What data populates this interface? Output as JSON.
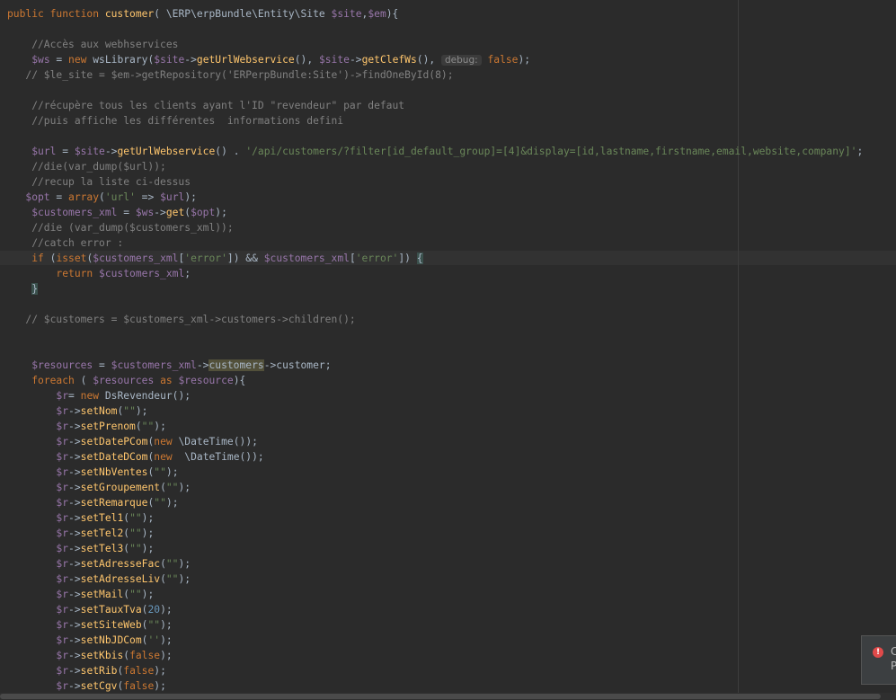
{
  "editor": {
    "lines": [
      [
        [
          "public function ",
          "kw"
        ],
        [
          "customer",
          "fn"
        ],
        [
          "( ",
          ""
        ],
        [
          "\\ERP\\erpBundle\\Entity\\Site",
          "cls"
        ],
        [
          " ",
          ""
        ],
        [
          "$site",
          "var"
        ],
        [
          ",",
          ""
        ],
        [
          "$em",
          "var"
        ],
        [
          "){",
          ""
        ]
      ],
      [],
      [
        [
          "    //Accès aux webhservices",
          "cmt"
        ]
      ],
      [
        [
          "    ",
          ""
        ],
        [
          "$ws",
          "var"
        ],
        [
          " = ",
          ""
        ],
        [
          "new ",
          "kw"
        ],
        [
          "wsLibrary(",
          ""
        ],
        [
          "$site",
          "var"
        ],
        [
          "->",
          ""
        ],
        [
          "getUrlWebservice",
          "fn"
        ],
        [
          "(), ",
          ""
        ],
        [
          "$site",
          "var"
        ],
        [
          "->",
          ""
        ],
        [
          "getClefWs",
          "fn"
        ],
        [
          "(), ",
          ""
        ],
        [
          "debug:",
          "hint"
        ],
        [
          " ",
          ""
        ],
        [
          "false",
          "kw"
        ],
        [
          ");",
          ""
        ]
      ],
      [
        [
          "   // $le_site = $em->getRepository('ERPerpBundle:Site')->findOneById(8);",
          "cmt"
        ]
      ],
      [],
      [
        [
          "    //récupère tous les clients ayant l'ID \"revendeur\" par defaut",
          "cmt"
        ]
      ],
      [
        [
          "    //puis affiche les différentes  informations defini",
          "cmt"
        ]
      ],
      [],
      [
        [
          "    ",
          ""
        ],
        [
          "$url",
          "var"
        ],
        [
          " = ",
          ""
        ],
        [
          "$site",
          "var"
        ],
        [
          "->",
          ""
        ],
        [
          "getUrlWebservice",
          "fn"
        ],
        [
          "() . ",
          ""
        ],
        [
          "'/api/customers/?filter[id_default_group]=[4]&display=[id,lastname,firstname,email,website,company]'",
          "str"
        ],
        [
          ";",
          ""
        ]
      ],
      [
        [
          "    //die(var_dump($url));",
          "cmt"
        ]
      ],
      [
        [
          "    //recup la liste ci-dessus",
          "cmt"
        ]
      ],
      [
        [
          "   ",
          ""
        ],
        [
          "$opt",
          "var"
        ],
        [
          " = ",
          ""
        ],
        [
          "array",
          "kw"
        ],
        [
          "(",
          ""
        ],
        [
          "'url'",
          "str"
        ],
        [
          " => ",
          ""
        ],
        [
          "$url",
          "var"
        ],
        [
          ");",
          ""
        ]
      ],
      [
        [
          "    ",
          ""
        ],
        [
          "$customers_xml",
          "var"
        ],
        [
          " = ",
          ""
        ],
        [
          "$ws",
          "var"
        ],
        [
          "->",
          ""
        ],
        [
          "get",
          "fn"
        ],
        [
          "(",
          ""
        ],
        [
          "$opt",
          "var"
        ],
        [
          ");",
          ""
        ]
      ],
      [
        [
          "    //die (var_dump($customers_xml));",
          "cmt"
        ]
      ],
      [
        [
          "    //catch error :",
          "cmt"
        ]
      ],
      [
        [
          "    ",
          ""
        ],
        [
          "if",
          "kw"
        ],
        [
          " (",
          ""
        ],
        [
          "isset",
          "kw"
        ],
        [
          "(",
          ""
        ],
        [
          "$customers_xml",
          "var"
        ],
        [
          "[",
          ""
        ],
        [
          "'error'",
          "str"
        ],
        [
          "]) && ",
          ""
        ],
        [
          "$customers_xml",
          "var"
        ],
        [
          "[",
          ""
        ],
        [
          "'error'",
          "str"
        ],
        [
          "]) ",
          ""
        ],
        [
          "{",
          "match"
        ]
      ],
      [
        [
          "        ",
          ""
        ],
        [
          "return ",
          "kw"
        ],
        [
          "$customers_xml",
          "var"
        ],
        [
          ";",
          ""
        ]
      ],
      [
        [
          "    ",
          ""
        ],
        [
          "}",
          "match"
        ]
      ],
      [],
      [
        [
          "   // $customers = $customers_xml->customers->children();",
          "cmt"
        ]
      ],
      [],
      [],
      [
        [
          "    ",
          ""
        ],
        [
          "$resources",
          "var"
        ],
        [
          " = ",
          ""
        ],
        [
          "$customers_xml",
          "var"
        ],
        [
          "->",
          ""
        ],
        [
          "customers",
          "occ"
        ],
        [
          "->customer;",
          ""
        ]
      ],
      [
        [
          "    ",
          ""
        ],
        [
          "foreach",
          "kw"
        ],
        [
          " ( ",
          ""
        ],
        [
          "$resources",
          "var"
        ],
        [
          " ",
          ""
        ],
        [
          "as",
          "kw"
        ],
        [
          " ",
          ""
        ],
        [
          "$resource",
          "var"
        ],
        [
          "){",
          ""
        ]
      ],
      [
        [
          "        ",
          ""
        ],
        [
          "$r",
          "var"
        ],
        [
          "= ",
          ""
        ],
        [
          "new ",
          "kw"
        ],
        [
          "DsRevendeur();",
          ""
        ]
      ],
      [
        [
          "        ",
          ""
        ],
        [
          "$r",
          "var"
        ],
        [
          "->",
          ""
        ],
        [
          "setNom",
          "fn"
        ],
        [
          "(",
          ""
        ],
        [
          "\"\"",
          "str"
        ],
        [
          ");",
          ""
        ]
      ],
      [
        [
          "        ",
          ""
        ],
        [
          "$r",
          "var"
        ],
        [
          "->",
          ""
        ],
        [
          "setPrenom",
          "fn"
        ],
        [
          "(",
          ""
        ],
        [
          "\"\"",
          "str"
        ],
        [
          ");",
          ""
        ]
      ],
      [
        [
          "        ",
          ""
        ],
        [
          "$r",
          "var"
        ],
        [
          "->",
          ""
        ],
        [
          "setDatePCom",
          "fn"
        ],
        [
          "(",
          ""
        ],
        [
          "new ",
          "kw"
        ],
        [
          "\\DateTime());",
          ""
        ]
      ],
      [
        [
          "        ",
          ""
        ],
        [
          "$r",
          "var"
        ],
        [
          "->",
          ""
        ],
        [
          "setDateDCom",
          "fn"
        ],
        [
          "(",
          ""
        ],
        [
          "new  ",
          "kw"
        ],
        [
          "\\DateTime());",
          ""
        ]
      ],
      [
        [
          "        ",
          ""
        ],
        [
          "$r",
          "var"
        ],
        [
          "->",
          ""
        ],
        [
          "setNbVentes",
          "fn"
        ],
        [
          "(",
          ""
        ],
        [
          "\"\"",
          "str"
        ],
        [
          ");",
          ""
        ]
      ],
      [
        [
          "        ",
          ""
        ],
        [
          "$r",
          "var"
        ],
        [
          "->",
          ""
        ],
        [
          "setGroupement",
          "fn"
        ],
        [
          "(",
          ""
        ],
        [
          "\"\"",
          "str"
        ],
        [
          ");",
          ""
        ]
      ],
      [
        [
          "        ",
          ""
        ],
        [
          "$r",
          "var"
        ],
        [
          "->",
          ""
        ],
        [
          "setRemarque",
          "fn"
        ],
        [
          "(",
          ""
        ],
        [
          "\"\"",
          "str"
        ],
        [
          ");",
          ""
        ]
      ],
      [
        [
          "        ",
          ""
        ],
        [
          "$r",
          "var"
        ],
        [
          "->",
          ""
        ],
        [
          "setTel1",
          "fn"
        ],
        [
          "(",
          ""
        ],
        [
          "\"\"",
          "str"
        ],
        [
          ");",
          ""
        ]
      ],
      [
        [
          "        ",
          ""
        ],
        [
          "$r",
          "var"
        ],
        [
          "->",
          ""
        ],
        [
          "setTel2",
          "fn"
        ],
        [
          "(",
          ""
        ],
        [
          "\"\"",
          "str"
        ],
        [
          ");",
          ""
        ]
      ],
      [
        [
          "        ",
          ""
        ],
        [
          "$r",
          "var"
        ],
        [
          "->",
          ""
        ],
        [
          "setTel3",
          "fn"
        ],
        [
          "(",
          ""
        ],
        [
          "\"\"",
          "str"
        ],
        [
          ");",
          ""
        ]
      ],
      [
        [
          "        ",
          ""
        ],
        [
          "$r",
          "var"
        ],
        [
          "->",
          ""
        ],
        [
          "setAdresseFac",
          "fn"
        ],
        [
          "(",
          ""
        ],
        [
          "\"\"",
          "str"
        ],
        [
          ");",
          ""
        ]
      ],
      [
        [
          "        ",
          ""
        ],
        [
          "$r",
          "var"
        ],
        [
          "->",
          ""
        ],
        [
          "setAdresseLiv",
          "fn"
        ],
        [
          "(",
          ""
        ],
        [
          "\"\"",
          "str"
        ],
        [
          ");",
          ""
        ]
      ],
      [
        [
          "        ",
          ""
        ],
        [
          "$r",
          "var"
        ],
        [
          "->",
          ""
        ],
        [
          "setMail",
          "fn"
        ],
        [
          "(",
          ""
        ],
        [
          "\"\"",
          "str"
        ],
        [
          ");",
          ""
        ]
      ],
      [
        [
          "        ",
          ""
        ],
        [
          "$r",
          "var"
        ],
        [
          "->",
          ""
        ],
        [
          "setTauxTva",
          "fn"
        ],
        [
          "(",
          ""
        ],
        [
          "20",
          "num"
        ],
        [
          ");",
          ""
        ]
      ],
      [
        [
          "        ",
          ""
        ],
        [
          "$r",
          "var"
        ],
        [
          "->",
          ""
        ],
        [
          "setSiteWeb",
          "fn"
        ],
        [
          "(",
          ""
        ],
        [
          "\"\"",
          "str"
        ],
        [
          ");",
          ""
        ]
      ],
      [
        [
          "        ",
          ""
        ],
        [
          "$r",
          "var"
        ],
        [
          "->",
          ""
        ],
        [
          "setNbJDCom",
          "fn"
        ],
        [
          "(",
          ""
        ],
        [
          "''",
          "str"
        ],
        [
          ");",
          ""
        ]
      ],
      [
        [
          "        ",
          ""
        ],
        [
          "$r",
          "var"
        ],
        [
          "->",
          ""
        ],
        [
          "setKbis",
          "fn"
        ],
        [
          "(",
          ""
        ],
        [
          "false",
          "kw"
        ],
        [
          ");",
          ""
        ]
      ],
      [
        [
          "        ",
          ""
        ],
        [
          "$r",
          "var"
        ],
        [
          "->",
          ""
        ],
        [
          "setRib",
          "fn"
        ],
        [
          "(",
          ""
        ],
        [
          "false",
          "kw"
        ],
        [
          ");",
          ""
        ]
      ],
      [
        [
          "        ",
          ""
        ],
        [
          "$r",
          "var"
        ],
        [
          "->",
          ""
        ],
        [
          "setCgv",
          "fn"
        ],
        [
          "(",
          ""
        ],
        [
          "false",
          "kw"
        ],
        [
          ");",
          ""
        ]
      ]
    ]
  },
  "notification": {
    "icon": "error-icon",
    "title": "C",
    "body": "P"
  },
  "colors": {
    "background": "#2b2b2b",
    "keyword": "#cc7832",
    "function": "#ffc66d",
    "variable": "#9876aa",
    "string": "#6a8759",
    "comment": "#808080",
    "number": "#6897bb",
    "default_text": "#a9b7c6"
  }
}
